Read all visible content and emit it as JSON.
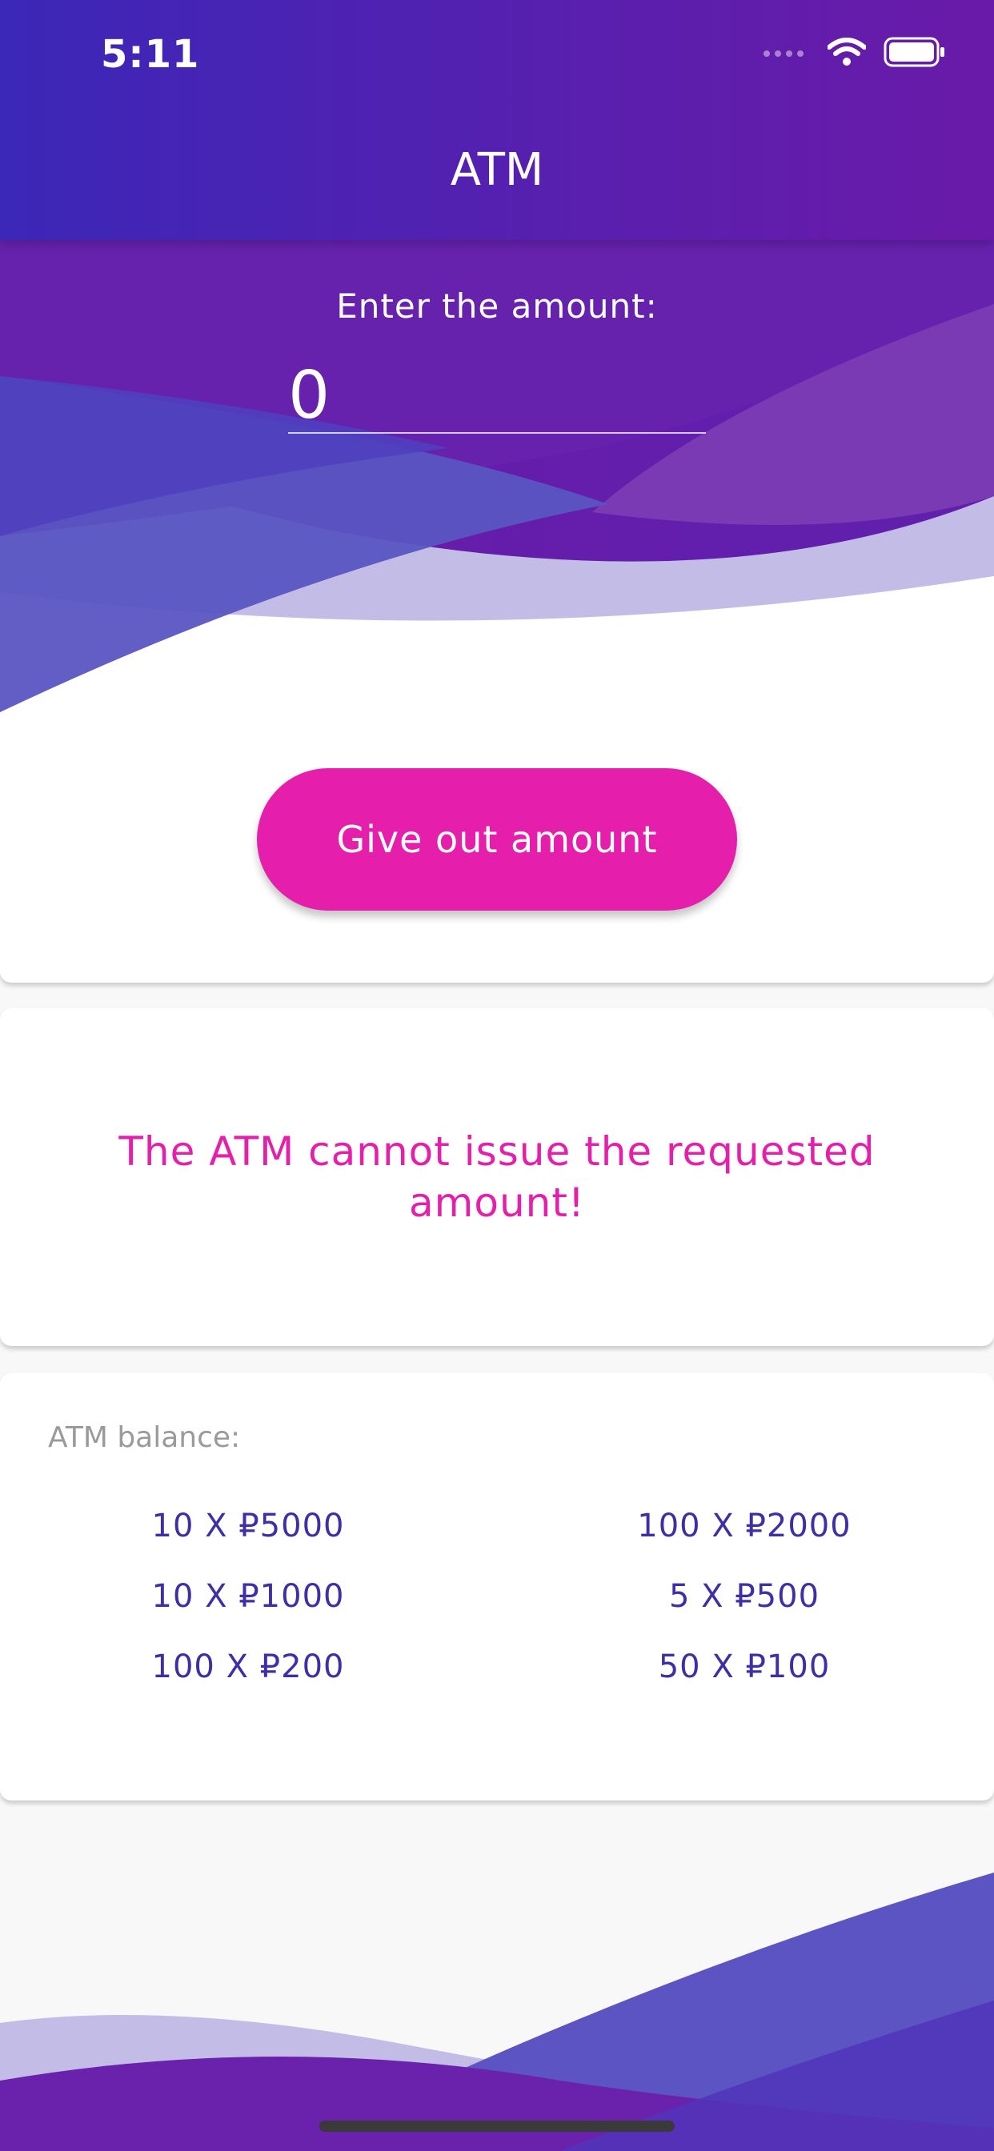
{
  "status_bar": {
    "time": "5:11"
  },
  "app_bar": {
    "title": "ATM"
  },
  "amount_form": {
    "prompt": "Enter the amount:",
    "value": "0",
    "button_label": "Give out amount"
  },
  "message": {
    "text": "The ATM cannot issue the requested amount!"
  },
  "balance": {
    "label": "ATM balance:",
    "items": [
      "10 X ₽5000",
      "100 X ₽2000",
      "10 X ₽1000",
      "5 X ₽500",
      "100 X ₽200",
      "50 X ₽100"
    ]
  },
  "colors": {
    "header_start": "#3b27b8",
    "header_end": "#6a1aa8",
    "accent": "#e51fac",
    "balance_text": "#3d2fa8"
  }
}
